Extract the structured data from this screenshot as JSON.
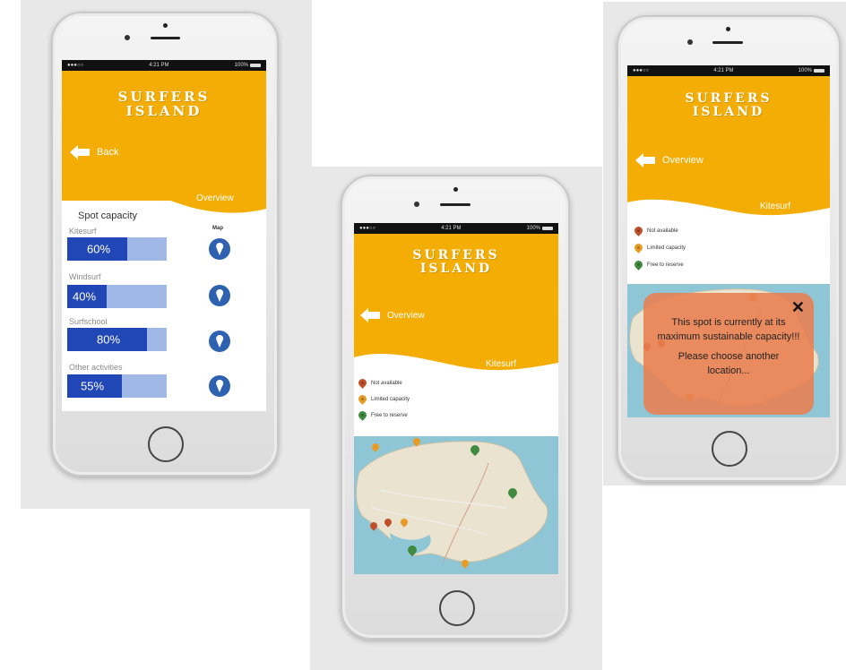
{
  "app": {
    "title": "SURFERS\nISLAND",
    "colors": {
      "header": "#f4ad05",
      "bar_fill": "#2146b5",
      "bar_track": "#9fb8e6",
      "map_pin_button": "#2e62b0",
      "popup": "#e97e50"
    }
  },
  "status_bar": {
    "time": "4:21 PM",
    "battery": "100%",
    "carrier": "●●●○○ ",
    "wifi_icon": "wifi-icon"
  },
  "screen1": {
    "back_label": "Back",
    "overview_label": "Overview",
    "capacity_title": "Spot capacity",
    "map_column_label": "Map",
    "activities": [
      {
        "label": "Kitesurf",
        "capacity": 0.6,
        "capacity_text": "60%"
      },
      {
        "label": "Windsurf",
        "capacity": 0.4,
        "capacity_text": "40%"
      },
      {
        "label": "Surfschool",
        "capacity": 0.8,
        "capacity_text": "80%"
      },
      {
        "label": "Other activities",
        "capacity": 0.55,
        "capacity_text": "55%"
      }
    ]
  },
  "screen2": {
    "overview_label": "Overview",
    "activity_label": "Kitesurf",
    "legend": [
      {
        "label": "Not available",
        "color": "red"
      },
      {
        "label": "Limited capacity",
        "color": "orange"
      },
      {
        "label": "Free to reserve",
        "color": "green"
      }
    ]
  },
  "screen3": {
    "overview_label": "Overview",
    "activity_label": "Kitesurf",
    "legend": [
      {
        "label": "Not available",
        "color": "red"
      },
      {
        "label": "Limited capacity",
        "color": "orange"
      },
      {
        "label": "Free to reserve",
        "color": "green"
      }
    ],
    "popup": {
      "close_icon": "close-icon",
      "message": "This spot is currently at its maximum sustainable capacity!!!",
      "hint": "Please choose another location..."
    }
  }
}
